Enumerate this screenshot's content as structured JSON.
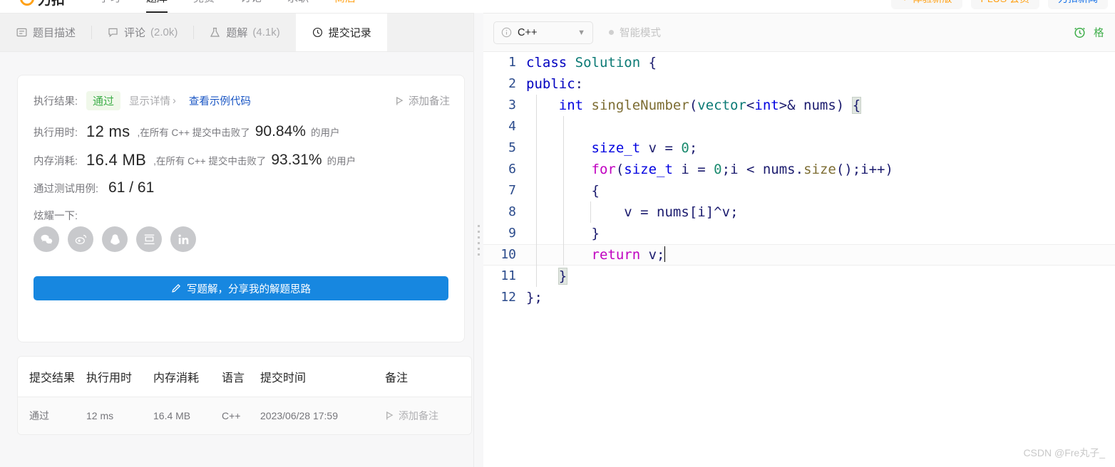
{
  "topnav": {
    "brand": "力扣",
    "items": [
      {
        "label": "学习",
        "state": "normal"
      },
      {
        "label": "题库",
        "state": "active"
      },
      {
        "label": "竞赛",
        "state": "normal"
      },
      {
        "label": "讨论",
        "state": "normal"
      },
      {
        "label": "求职",
        "state": "normal"
      },
      {
        "label": "商店",
        "state": "highlight"
      }
    ],
    "right": [
      {
        "label": "体验新版",
        "style": "orange",
        "dot": "▼"
      },
      {
        "label": "PLUS 会员",
        "style": "orange",
        "dot": ""
      },
      {
        "label": "力扣新闻",
        "style": "blue",
        "dot": ""
      }
    ]
  },
  "left": {
    "tabs": [
      {
        "label": "题目描述",
        "count": "",
        "icon": "description-icon",
        "active": false
      },
      {
        "label": "评论",
        "count": "(2.0k)",
        "icon": "comment-icon",
        "active": false
      },
      {
        "label": "题解",
        "count": "(4.1k)",
        "icon": "flask-icon",
        "active": false
      },
      {
        "label": "提交记录",
        "count": "",
        "icon": "clock-icon",
        "active": true
      }
    ],
    "result": {
      "result_label": "执行结果:",
      "status": "通过",
      "show_detail": "显示详情",
      "show_detail_chevron": "›",
      "sample_code": "查看示例代码",
      "add_note": "添加备注",
      "runtime_label": "执行用时:",
      "runtime_value": "12 ms",
      "runtime_prefix": ",在所有 C++ 提交中击败了",
      "runtime_pct": "90.84%",
      "runtime_suffix": "的用户",
      "memory_label": "内存消耗:",
      "memory_value": "16.4 MB",
      "memory_prefix": ",在所有 C++ 提交中击败了",
      "memory_pct": "93.31%",
      "memory_suffix": "的用户",
      "cases_label": "通过测试用例:",
      "cases_value": "61 / 61",
      "share_label": "炫耀一下:",
      "share_icons": [
        "wechat-icon",
        "weibo-icon",
        "qq-icon",
        "douban-icon",
        "linkedin-icon"
      ],
      "cta_label": "写题解，分享我的解题思路"
    },
    "history": {
      "columns": [
        "提交结果",
        "执行用时",
        "内存消耗",
        "语言",
        "提交时间",
        "备注"
      ],
      "rows": [
        {
          "status": "通过",
          "runtime": "12 ms",
          "memory": "16.4 MB",
          "language": "C++",
          "time": "2023/06/28 17:59",
          "note": "添加备注"
        }
      ]
    }
  },
  "editor": {
    "language": "C++",
    "smart_mode": "智能模式",
    "code_lines": [
      {
        "n": "1",
        "active": false,
        "guides": 0,
        "tokens": [
          {
            "t": "class",
            "c": "k-class"
          },
          {
            "t": " ",
            "c": "k-plain"
          },
          {
            "t": "Solution",
            "c": "k-type"
          },
          {
            "t": " {",
            "c": "k-punct"
          }
        ]
      },
      {
        "n": "2",
        "active": false,
        "guides": 0,
        "tokens": [
          {
            "t": "public",
            "c": "k-class"
          },
          {
            "t": ":",
            "c": "k-punct"
          }
        ]
      },
      {
        "n": "3",
        "active": false,
        "guides": 1,
        "tokens": [
          {
            "t": "    ",
            "c": "k-plain"
          },
          {
            "t": "int",
            "c": "k-blue"
          },
          {
            "t": " ",
            "c": "k-plain"
          },
          {
            "t": "singleNumber",
            "c": "k-fn"
          },
          {
            "t": "(",
            "c": "k-punct"
          },
          {
            "t": "vector",
            "c": "k-type"
          },
          {
            "t": "<",
            "c": "k-punct"
          },
          {
            "t": "int",
            "c": "k-blue"
          },
          {
            "t": ">& ",
            "c": "k-punct"
          },
          {
            "t": "nums",
            "c": "k-plain"
          },
          {
            "t": ") ",
            "c": "k-punct"
          },
          {
            "t": "{",
            "c": "k-punct brace-hl"
          }
        ]
      },
      {
        "n": "4",
        "active": false,
        "guides": 2,
        "tokens": []
      },
      {
        "n": "5",
        "active": false,
        "guides": 2,
        "tokens": [
          {
            "t": "        ",
            "c": "k-plain"
          },
          {
            "t": "size_t",
            "c": "k-blue"
          },
          {
            "t": " v ",
            "c": "k-plain"
          },
          {
            "t": "= ",
            "c": "k-punct"
          },
          {
            "t": "0",
            "c": "k-num"
          },
          {
            "t": ";",
            "c": "k-punct"
          }
        ]
      },
      {
        "n": "6",
        "active": false,
        "guides": 2,
        "tokens": [
          {
            "t": "        ",
            "c": "k-plain"
          },
          {
            "t": "for",
            "c": "k-magenta"
          },
          {
            "t": "(",
            "c": "k-punct"
          },
          {
            "t": "size_t",
            "c": "k-blue"
          },
          {
            "t": " i ",
            "c": "k-plain"
          },
          {
            "t": "= ",
            "c": "k-punct"
          },
          {
            "t": "0",
            "c": "k-num"
          },
          {
            "t": ";",
            "c": "k-punct"
          },
          {
            "t": "i ",
            "c": "k-plain"
          },
          {
            "t": "< ",
            "c": "k-punct"
          },
          {
            "t": "nums",
            "c": "k-plain"
          },
          {
            "t": ".",
            "c": "k-punct"
          },
          {
            "t": "size",
            "c": "k-fn"
          },
          {
            "t": "();",
            "c": "k-punct"
          },
          {
            "t": "i",
            "c": "k-plain"
          },
          {
            "t": "++)",
            "c": "k-punct"
          }
        ]
      },
      {
        "n": "7",
        "active": false,
        "guides": 2,
        "tokens": [
          {
            "t": "        ",
            "c": "k-plain"
          },
          {
            "t": "{",
            "c": "k-punct"
          }
        ]
      },
      {
        "n": "8",
        "active": false,
        "guides": 3,
        "tokens": [
          {
            "t": "            v ",
            "c": "k-plain"
          },
          {
            "t": "= ",
            "c": "k-punct"
          },
          {
            "t": "nums",
            "c": "k-plain"
          },
          {
            "t": "[",
            "c": "k-punct"
          },
          {
            "t": "i",
            "c": "k-plain"
          },
          {
            "t": "]^",
            "c": "k-punct"
          },
          {
            "t": "v",
            "c": "k-plain"
          },
          {
            "t": ";",
            "c": "k-punct"
          }
        ]
      },
      {
        "n": "9",
        "active": false,
        "guides": 2,
        "tokens": [
          {
            "t": "        ",
            "c": "k-plain"
          },
          {
            "t": "}",
            "c": "k-punct"
          }
        ]
      },
      {
        "n": "10",
        "active": true,
        "guides": 2,
        "caret": true,
        "tokens": [
          {
            "t": "        ",
            "c": "k-plain"
          },
          {
            "t": "return",
            "c": "k-magenta"
          },
          {
            "t": " v",
            "c": "k-plain"
          },
          {
            "t": ";",
            "c": "k-punct"
          }
        ]
      },
      {
        "n": "11",
        "active": false,
        "guides": 1,
        "tokens": [
          {
            "t": "    ",
            "c": "k-plain"
          },
          {
            "t": "}",
            "c": "k-punct brace-hl"
          }
        ]
      },
      {
        "n": "12",
        "active": false,
        "guides": 0,
        "tokens": [
          {
            "t": "};",
            "c": "k-punct"
          }
        ]
      }
    ]
  },
  "watermark": "CSDN @Fre丸子_",
  "colors": {
    "accent_orange": "#ffa116",
    "pass_green": "#3fae4a",
    "cta_blue": "#1787e0",
    "link_blue": "#1a56c4"
  }
}
